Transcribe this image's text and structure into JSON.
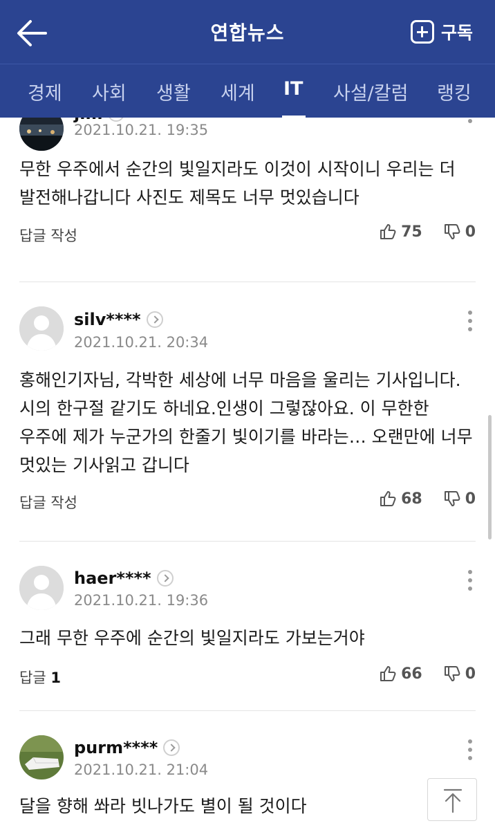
{
  "header": {
    "title": "연합뉴스",
    "subscribe_label": "구독"
  },
  "tabs": [
    "경제",
    "사회",
    "생활",
    "세계",
    "IT",
    "사설/칼럼",
    "랭킹"
  ],
  "active_tab": "IT",
  "comments": [
    {
      "username": "jim",
      "date": "2021.10.21. 19:35",
      "text": "무한 우주에서 순간의 빛일지라도 이것이 시작이니 우리는 더 발전해나갑니다 사진도 제목도 너무 멋있습니다",
      "reply": "답글 작성",
      "reply_count": "",
      "likes": "75",
      "dislikes": "0"
    },
    {
      "username": "silv****",
      "date": "2021.10.21. 20:34",
      "text": "홍해인기자님, 각박한 세상에 너무 마음을 울리는 기사입니다. 시의 한구절 같기도 하네요.인생이 그렇잖아요. 이 무한한 우주에 제가 누군가의 한줄기 빛이기를 바라는… 오랜만에 너무 멋있는 기사읽고 갑니다",
      "reply": "답글 작성",
      "reply_count": "",
      "likes": "68",
      "dislikes": "0"
    },
    {
      "username": "haer****",
      "date": "2021.10.21. 19:36",
      "text": "그래 무한 우주에 순간의 빛일지라도 가보는거야",
      "reply": "답글",
      "reply_count": "1",
      "likes": "66",
      "dislikes": "0"
    },
    {
      "username": "purm****",
      "date": "2021.10.21. 21:04",
      "text": "달을 향해 쏴라 빗나가도 별이 될 것이다",
      "reply": "",
      "reply_count": "",
      "likes": "",
      "dislikes": ""
    }
  ],
  "icons": [
    "back-arrow-icon",
    "plus-icon",
    "thumbs-up-icon",
    "thumbs-down-icon",
    "kebab-menu-icon",
    "chevron-right-icon",
    "arrow-up-icon"
  ],
  "colors": {
    "header_bg": "#2b4491",
    "tab_inactive": "#c7d1ee",
    "meta_gray": "#8a8a8a"
  }
}
